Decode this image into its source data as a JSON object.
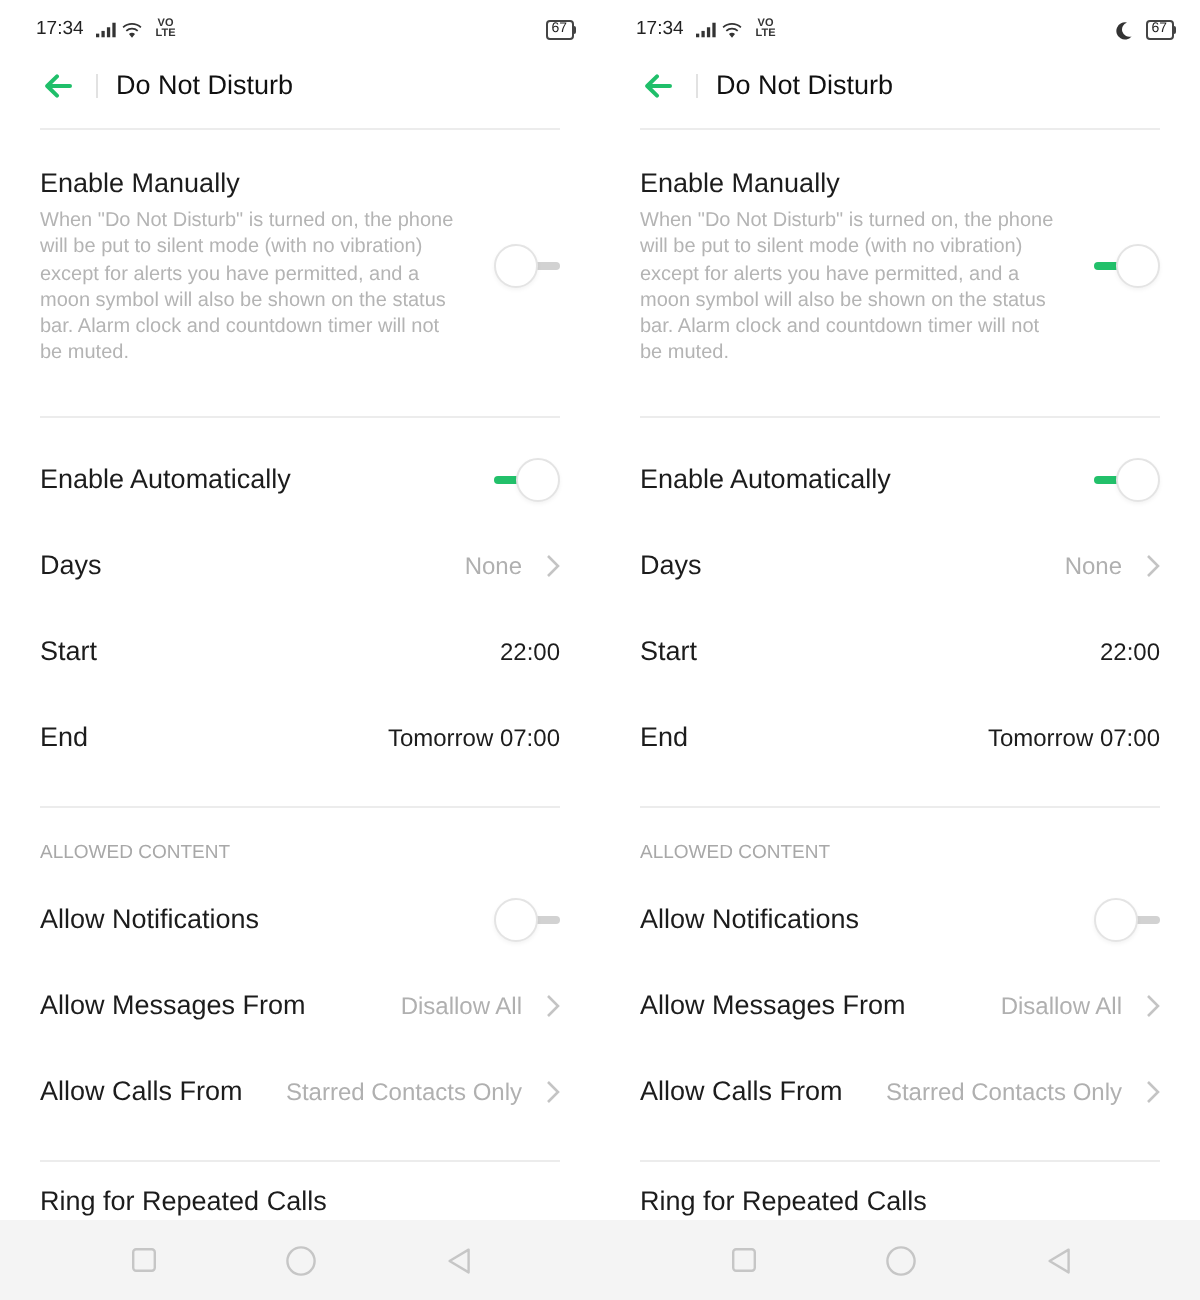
{
  "screens": [
    {
      "status_bar": {
        "time": "17:34",
        "network_badge": "VO LTE",
        "moon": false,
        "battery": "67"
      },
      "header": {
        "title": "Do Not Disturb"
      },
      "sections": [
        {
          "items": [
            {
              "kind": "toggle",
              "label": "Enable Manually",
              "description": "When \"Do Not Disturb\" is turned on, the phone will be put to silent mode (with no vibration) except for alerts you have permitted, and a moon symbol will also be shown on the status bar. Alarm clock and countdown timer will not be muted.",
              "on": false
            }
          ]
        },
        {
          "items": [
            {
              "kind": "toggle",
              "label": "Enable Automatically",
              "on": true
            },
            {
              "kind": "link",
              "label": "Days",
              "value": "None"
            },
            {
              "kind": "value",
              "label": "Start",
              "value": "22:00"
            },
            {
              "kind": "value",
              "label": "End",
              "value": "Tomorrow 07:00"
            }
          ]
        },
        {
          "heading": "ALLOWED CONTENT",
          "items": [
            {
              "kind": "toggle",
              "label": "Allow Notifications",
              "on": false
            },
            {
              "kind": "link",
              "label": "Allow Messages From",
              "value": "Disallow All"
            },
            {
              "kind": "link",
              "label": "Allow Calls From",
              "value": "Starred Contacts Only"
            }
          ]
        },
        {
          "items": [
            {
              "kind": "plain",
              "label": "Ring for Repeated Calls"
            }
          ]
        }
      ]
    },
    {
      "status_bar": {
        "time": "17:34",
        "network_badge": "VO LTE",
        "moon": true,
        "battery": "67"
      },
      "header": {
        "title": "Do Not Disturb"
      },
      "sections": [
        {
          "items": [
            {
              "kind": "toggle",
              "label": "Enable Manually",
              "description": "When \"Do Not Disturb\" is turned on, the phone will be put to silent mode (with no vibration) except for alerts you have permitted, and a moon symbol will also be shown on the status bar. Alarm clock and countdown timer will not be muted.",
              "on": true
            }
          ]
        },
        {
          "items": [
            {
              "kind": "toggle",
              "label": "Enable Automatically",
              "on": true
            },
            {
              "kind": "link",
              "label": "Days",
              "value": "None"
            },
            {
              "kind": "value",
              "label": "Start",
              "value": "22:00"
            },
            {
              "kind": "value",
              "label": "End",
              "value": "Tomorrow 07:00"
            }
          ]
        },
        {
          "heading": "ALLOWED CONTENT",
          "items": [
            {
              "kind": "toggle",
              "label": "Allow Notifications",
              "on": false
            },
            {
              "kind": "link",
              "label": "Allow Messages From",
              "value": "Disallow All"
            },
            {
              "kind": "link",
              "label": "Allow Calls From",
              "value": "Starred Contacts Only"
            }
          ]
        },
        {
          "items": [
            {
              "kind": "plain",
              "label": "Ring for Repeated Calls"
            }
          ]
        }
      ]
    }
  ]
}
